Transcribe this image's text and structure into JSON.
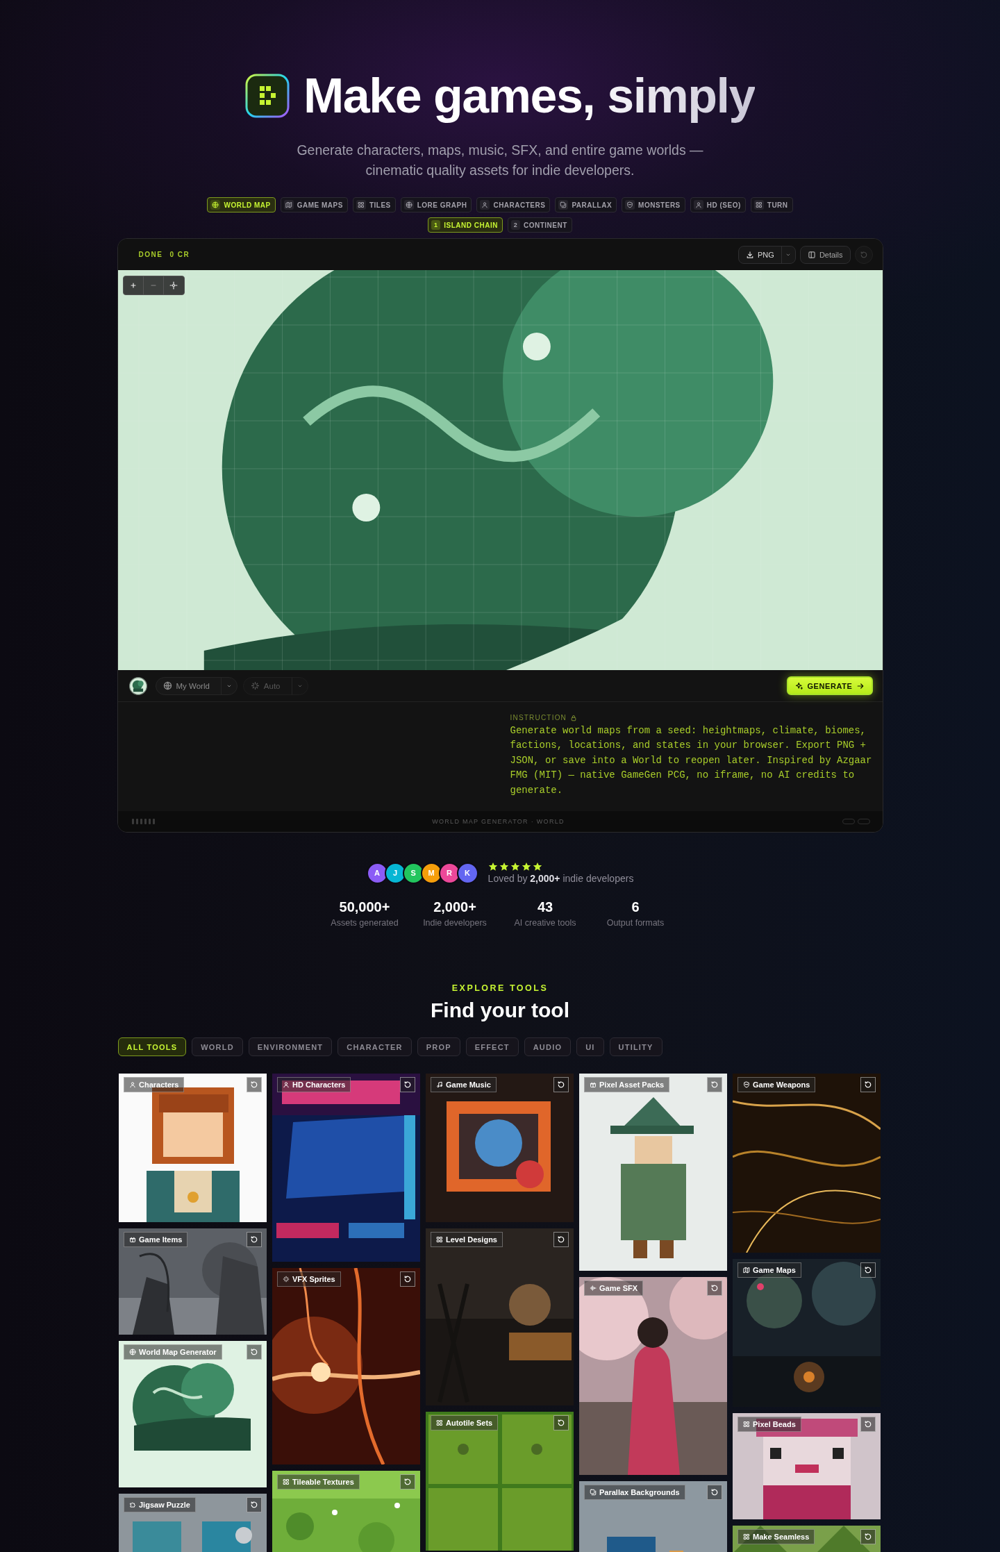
{
  "hero": {
    "title": "Make games, simply",
    "subtitle": "Generate characters, maps, music, SFX, and entire game worlds — cinematic quality assets for indie developers."
  },
  "tool_tabs": [
    {
      "label": "WORLD MAP",
      "selected": true
    },
    {
      "label": "GAME MAPS",
      "selected": false
    },
    {
      "label": "TILES",
      "selected": false
    },
    {
      "label": "LORE GRAPH",
      "selected": false
    },
    {
      "label": "CHARACTERS",
      "selected": false
    },
    {
      "label": "PARALLAX",
      "selected": false
    },
    {
      "label": "MONSTERS",
      "selected": false
    },
    {
      "label": "HD (SEO)",
      "selected": false
    },
    {
      "label": "TURN",
      "selected": false
    }
  ],
  "preset_tabs": [
    {
      "number": "1",
      "label": "ISLAND CHAIN",
      "selected": true
    },
    {
      "number": "2",
      "label": "CONTINENT",
      "selected": false
    }
  ],
  "generator": {
    "status": "DONE",
    "credits": "0 CR",
    "export_format": "PNG",
    "details_label": "Details",
    "world_select": "My World",
    "mode_select": {
      "value": "Auto",
      "disabled": true
    },
    "generate_label": "GENERATE",
    "instruction_label": "INSTRUCTION",
    "instruction": "Generate world maps from a seed: heightmaps, climate, biomes, factions, locations, and states in your browser. Export PNG + JSON, or save into a World to reopen later. Inspired by Azgaar FMG (MIT) — native GameGen PCG, no iframe, no AI credits to generate.",
    "footer": "WORLD MAP GENERATOR · WORLD"
  },
  "social_proof": {
    "avatars": [
      {
        "initial": "A",
        "color": "#8b5cf6"
      },
      {
        "initial": "J",
        "color": "#06b6d4"
      },
      {
        "initial": "S",
        "color": "#22c55e"
      },
      {
        "initial": "M",
        "color": "#f59e0b"
      },
      {
        "initial": "R",
        "color": "#ec4899"
      },
      {
        "initial": "K",
        "color": "#6366f1"
      }
    ],
    "stars": 5,
    "text": "Loved by **2,000+** indie developers"
  },
  "stats": [
    {
      "value": "50,000+",
      "label": "Assets generated"
    },
    {
      "value": "2,000+",
      "label": "Indie developers"
    },
    {
      "value": "43",
      "label": "AI creative tools"
    },
    {
      "value": "6",
      "label": "Output formats"
    }
  ],
  "explore": {
    "eyebrow": "EXPLORE TOOLS",
    "title": "Find your tool",
    "filters": [
      {
        "label": "ALL TOOLS",
        "selected": true
      },
      {
        "label": "WORLD",
        "selected": false
      },
      {
        "label": "ENVIRONMENT",
        "selected": false
      },
      {
        "label": "CHARACTER",
        "selected": false
      },
      {
        "label": "PROP",
        "selected": false
      },
      {
        "label": "EFFECT",
        "selected": false
      },
      {
        "label": "AUDIO",
        "selected": false
      },
      {
        "label": "UI",
        "selected": false
      },
      {
        "label": "UTILITY",
        "selected": false
      }
    ],
    "tool_columns": [
      [
        {
          "name": "Characters"
        },
        {
          "name": "Game Items"
        },
        {
          "name": "World Map Generator"
        },
        {
          "name": "Jigsaw Puzzle"
        }
      ],
      [
        {
          "name": "HD Characters"
        },
        {
          "name": "VFX Sprites"
        },
        {
          "name": "Tileable Textures"
        }
      ],
      [
        {
          "name": "Game Music"
        },
        {
          "name": "Level Designs"
        },
        {
          "name": "Autotile Sets"
        }
      ],
      [
        {
          "name": "Pixel Asset Packs"
        },
        {
          "name": "Game SFX"
        },
        {
          "name": "Parallax Backgrounds"
        }
      ],
      [
        {
          "name": "Game Weapons"
        },
        {
          "name": "Game Maps"
        },
        {
          "name": "Pixel Beads"
        },
        {
          "name": "Make Seamless"
        }
      ]
    ]
  }
}
